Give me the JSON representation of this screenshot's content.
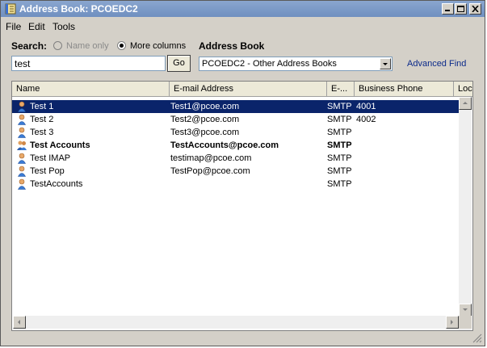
{
  "window": {
    "title": "Address Book: PCOEDC2",
    "icon": "address-book-icon"
  },
  "menu": [
    "File",
    "Edit",
    "Tools"
  ],
  "search": {
    "label": "Search:",
    "value": "test",
    "option_name_only": "Name only",
    "option_more_columns": "More columns",
    "selected_option": "More columns",
    "go_label": "Go"
  },
  "address_book": {
    "label": "Address Book",
    "selected": "PCOEDC2 - Other Address Books",
    "advanced_find": "Advanced Find"
  },
  "list": {
    "columns": [
      "Name",
      "E-mail Address",
      "E-...",
      "Business Phone",
      "Loca"
    ],
    "rows": [
      {
        "name": "Test 1",
        "email": "Test1@pcoe.com",
        "type": "SMTP",
        "phone": "4001",
        "icon": "user-icon",
        "selected": true,
        "bold": false
      },
      {
        "name": "Test 2",
        "email": "Test2@pcoe.com",
        "type": "SMTP",
        "phone": "4002",
        "icon": "user-icon",
        "selected": false,
        "bold": false
      },
      {
        "name": "Test 3",
        "email": "Test3@pcoe.com",
        "type": "SMTP",
        "phone": "",
        "icon": "user-icon",
        "selected": false,
        "bold": false
      },
      {
        "name": "Test Accounts",
        "email": "TestAccounts@pcoe.com",
        "type": "SMTP",
        "phone": "",
        "icon": "group-icon",
        "selected": false,
        "bold": true
      },
      {
        "name": "Test IMAP",
        "email": "testimap@pcoe.com",
        "type": "SMTP",
        "phone": "",
        "icon": "user-icon",
        "selected": false,
        "bold": false
      },
      {
        "name": "Test Pop",
        "email": "TestPop@pcoe.com",
        "type": "SMTP",
        "phone": "",
        "icon": "user-icon",
        "selected": false,
        "bold": false
      },
      {
        "name": "TestAccounts",
        "email": "",
        "type": "SMTP",
        "phone": "",
        "icon": "user-icon",
        "selected": false,
        "bold": false
      }
    ]
  },
  "colors": {
    "title_bar": "#7a97c6",
    "selection": "#0a246a",
    "link": "#0b2a8a",
    "window_bg": "#d4d0c8"
  }
}
